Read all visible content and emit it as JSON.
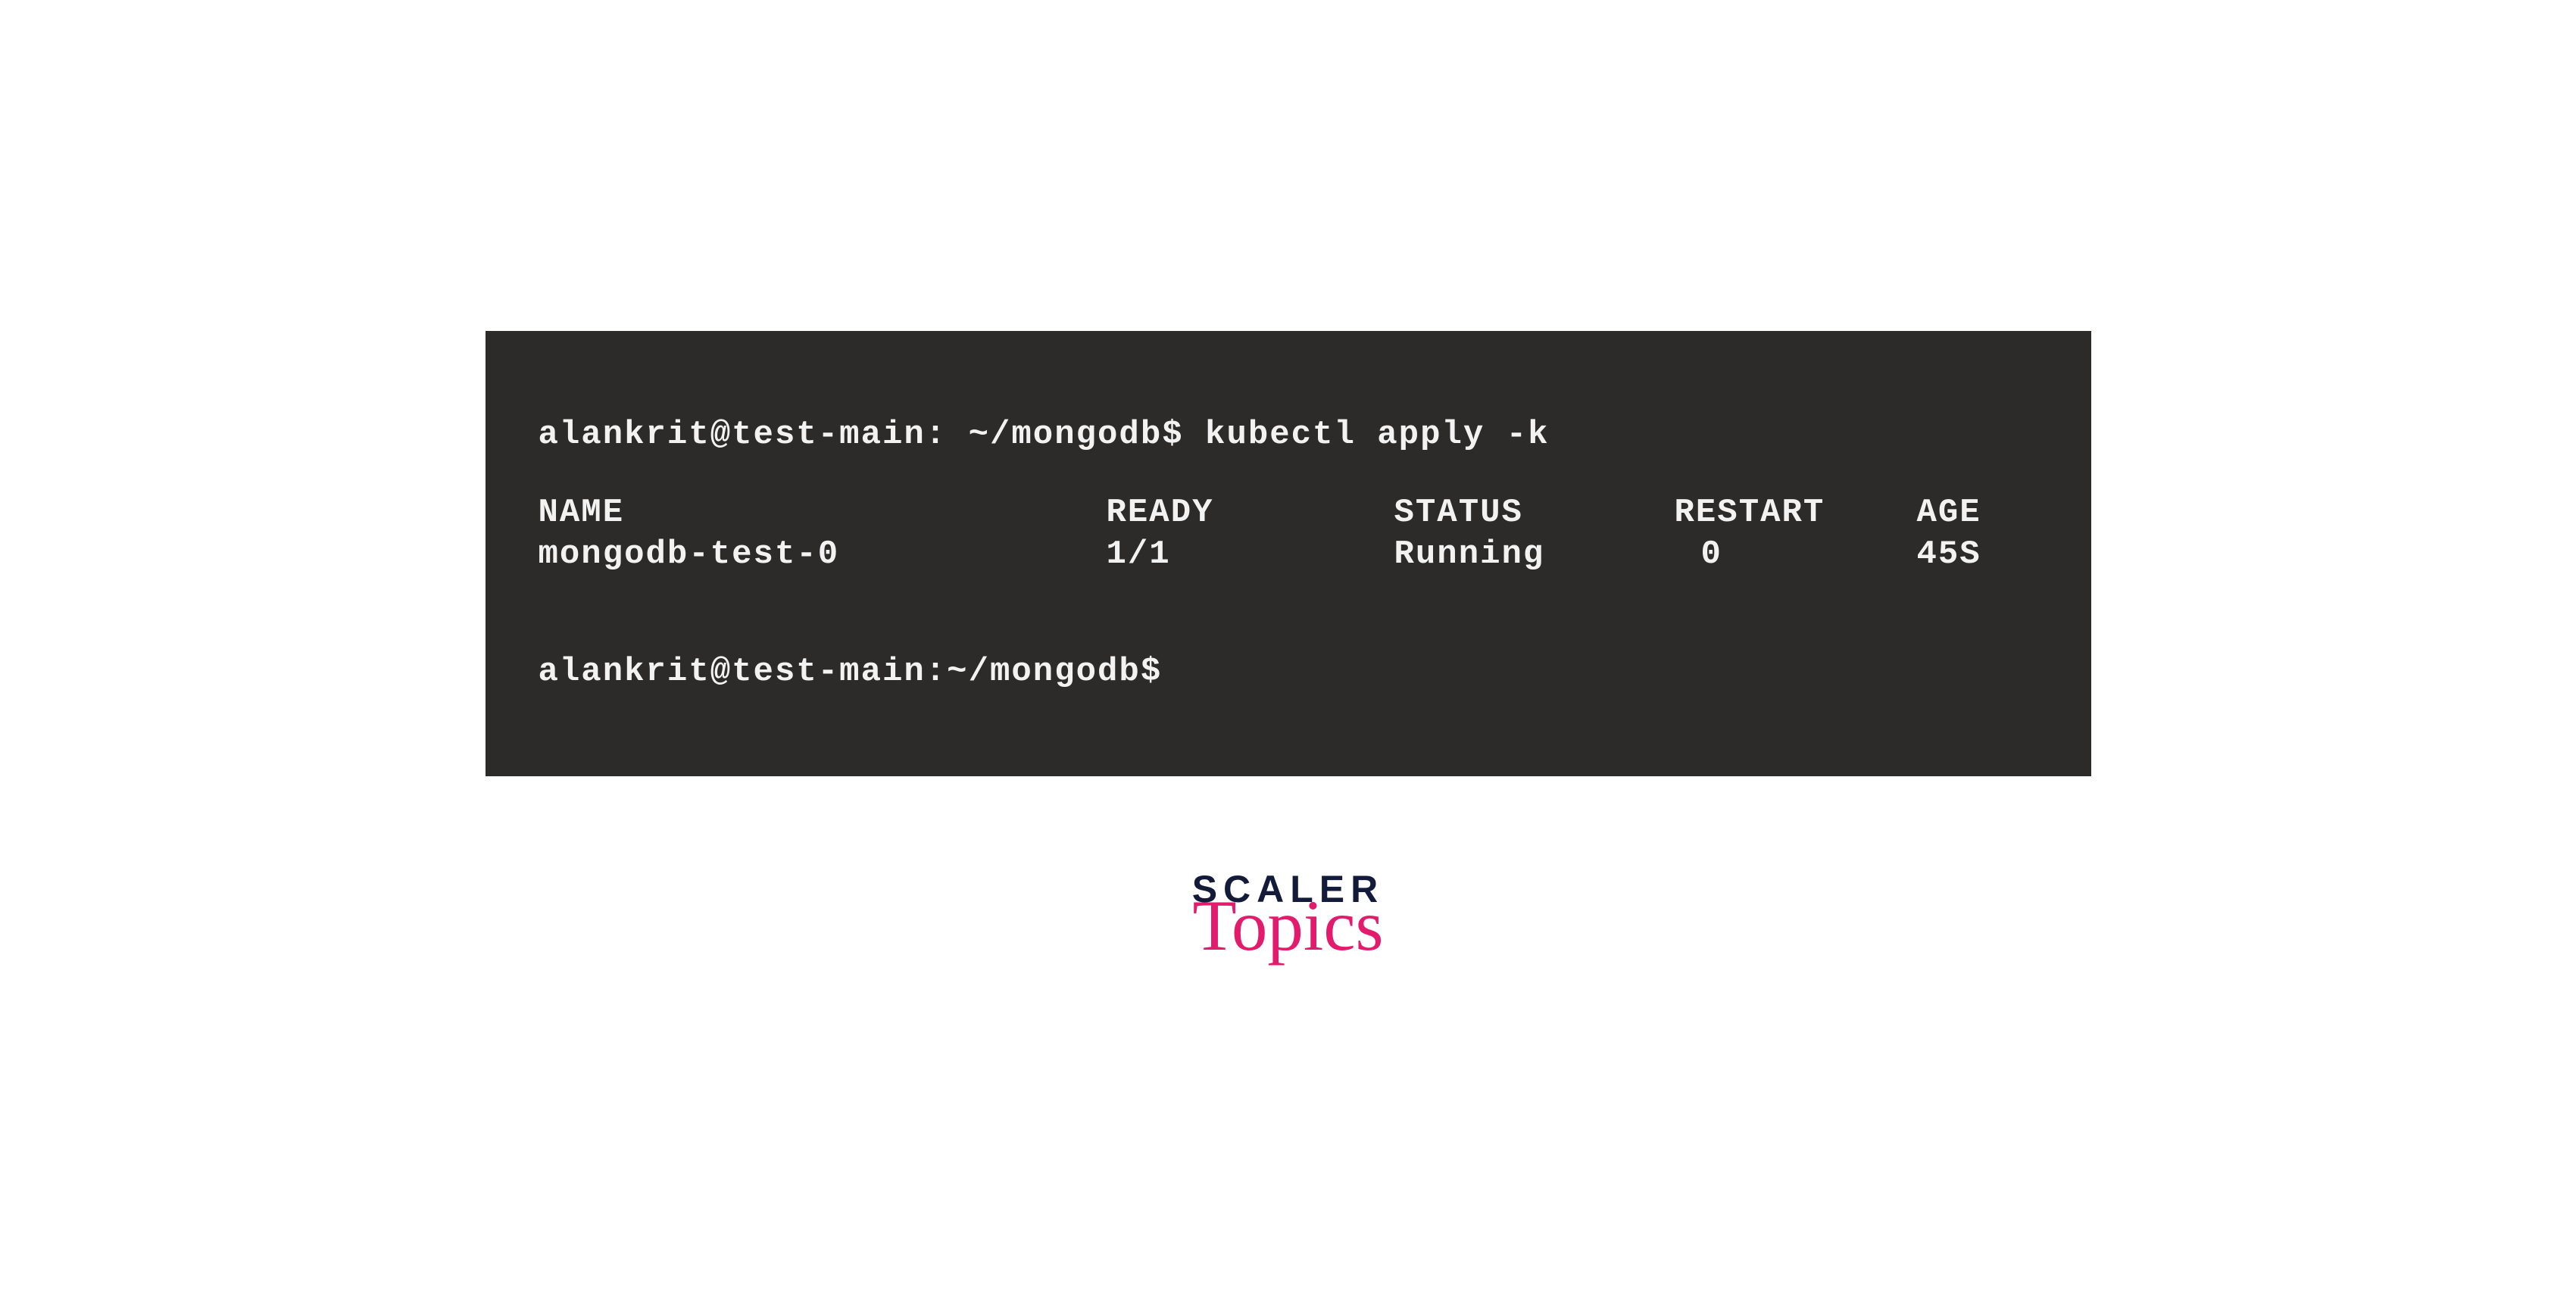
{
  "terminal": {
    "prompt1": "alankrit@test-main: ~/mongodb$ kubectl apply -k",
    "headers": {
      "name": "NAME",
      "ready": "READY",
      "status": "STATUS",
      "restart": "RESTART",
      "age": "AGE"
    },
    "row": {
      "name": "mongodb-test-0",
      "ready": "1/1",
      "status": "Running",
      "restart": "0",
      "age": "45S"
    },
    "prompt2": "alankrit@test-main:~/mongodb$"
  },
  "logo": {
    "line1": "SCALER",
    "line2": "Topics"
  }
}
